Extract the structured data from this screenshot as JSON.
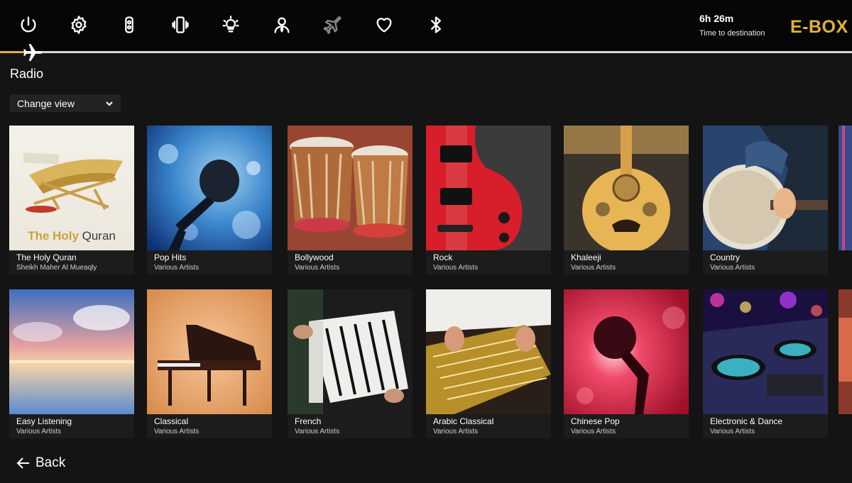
{
  "top_icons": [
    {
      "name": "power-icon"
    },
    {
      "name": "settings-icon"
    },
    {
      "name": "remote-control-icon"
    },
    {
      "name": "phone-vibrate-icon"
    },
    {
      "name": "reading-light-icon"
    },
    {
      "name": "call-attendant-icon"
    },
    {
      "name": "airplane-icon"
    },
    {
      "name": "heart-icon"
    },
    {
      "name": "bluetooth-icon"
    }
  ],
  "flight": {
    "time_remaining": "6h 26m",
    "time_label": "Time to destination",
    "progress": 0.03
  },
  "brand": "E-BOX",
  "page_title": "Radio",
  "view_selector": "Change view",
  "back_label": "Back",
  "quran_art_text": {
    "bold": "The Holy",
    "rest": " Quran"
  },
  "tiles": [
    {
      "title": "The Holy Quran",
      "artist": "Sheikh Maher Al Mueaqly"
    },
    {
      "title": "Pop Hits",
      "artist": "Various Artists"
    },
    {
      "title": "Bollywood",
      "artist": "Various Artists"
    },
    {
      "title": "Rock",
      "artist": "Various Artists"
    },
    {
      "title": "Khaleeji",
      "artist": "Various Artists"
    },
    {
      "title": "Country",
      "artist": "Various Artists"
    },
    {
      "title": "Easy Listening",
      "artist": "Various Artists"
    },
    {
      "title": "Classical",
      "artist": "Various Artists"
    },
    {
      "title": "French",
      "artist": "Various Artists"
    },
    {
      "title": "Arabic Classical",
      "artist": "Various Artists"
    },
    {
      "title": "Chinese Pop",
      "artist": "Various Artists"
    },
    {
      "title": "Electronic & Dance",
      "artist": "Various Artists"
    }
  ],
  "colors": {
    "accent": "#e2b136",
    "background": "#141414",
    "topbar": "#060606"
  }
}
